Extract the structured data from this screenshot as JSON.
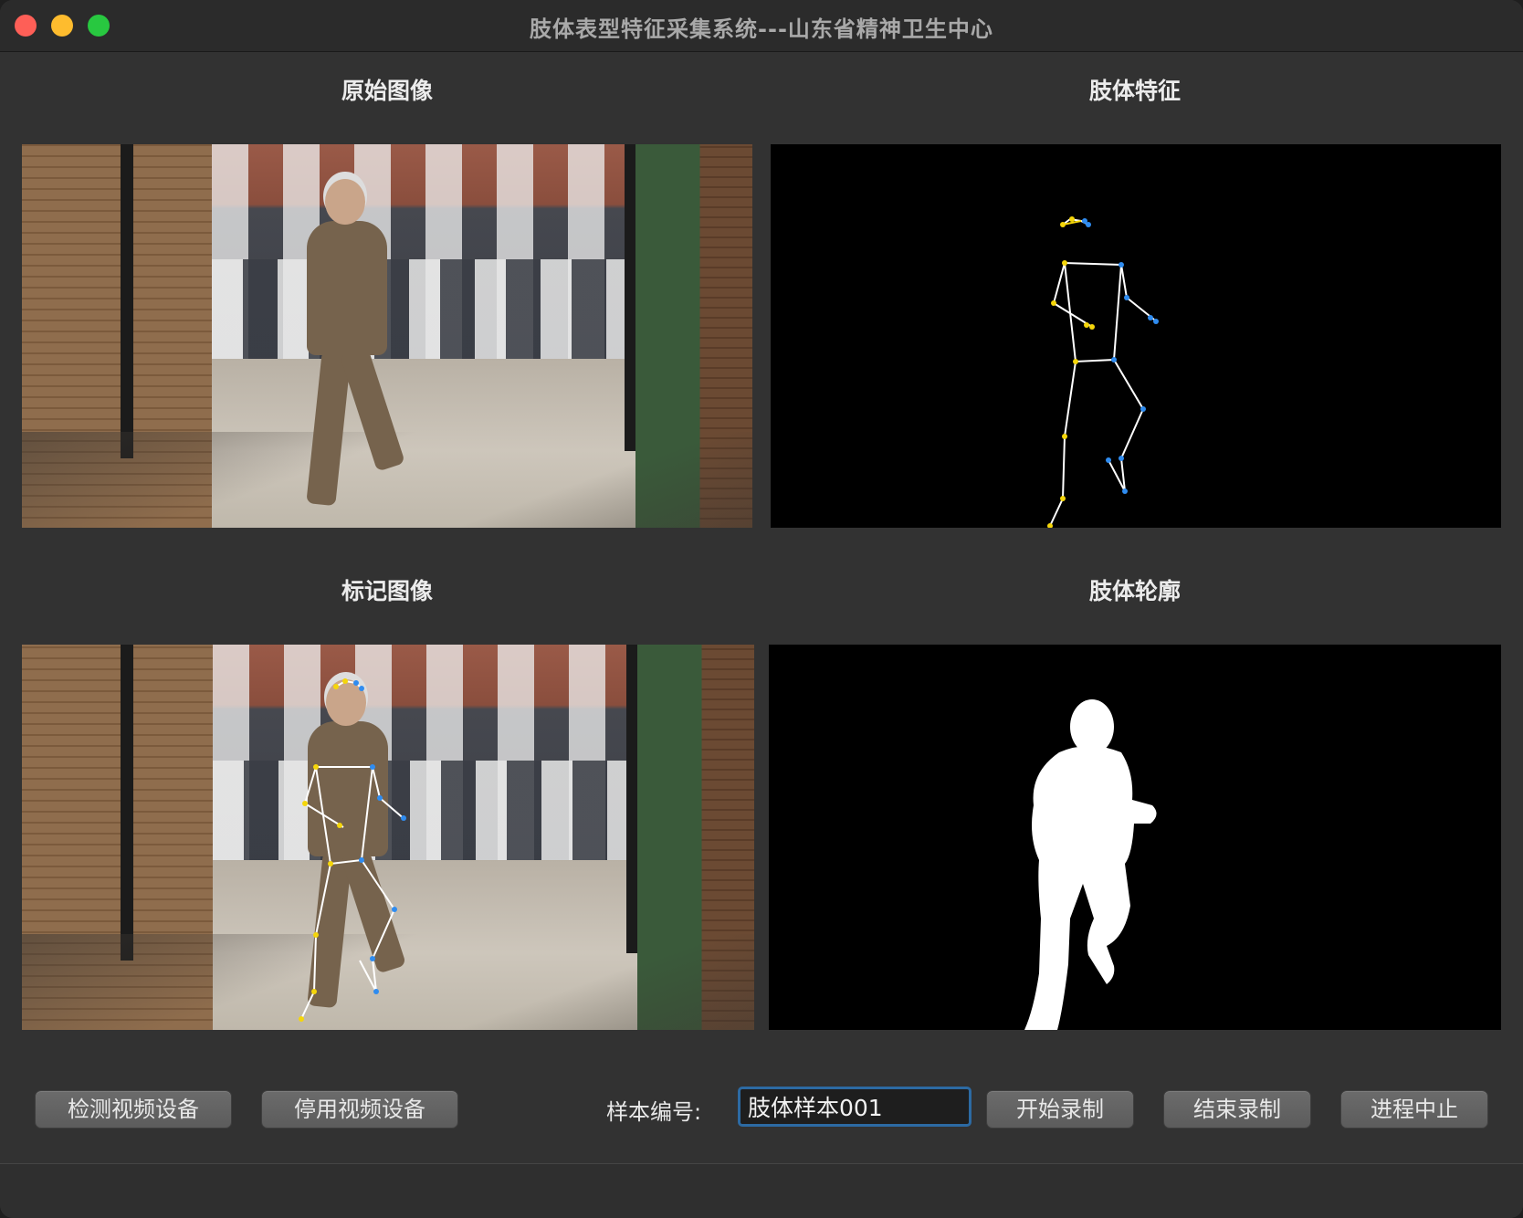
{
  "window": {
    "title": "肢体表型特征采集系统---山东省精神卫生中心"
  },
  "panels": {
    "original": "原始图像",
    "features": "肢体特征",
    "marked": "标记图像",
    "contour": "肢体轮廓"
  },
  "controls": {
    "detect_button": "检测视频设备",
    "disable_button": "停用视频设备",
    "sample_label": "样本编号:",
    "sample_value": "肢体样本001",
    "start_button": "开始录制",
    "stop_button": "结束录制",
    "abort_button": "进程中止"
  },
  "colors": {
    "accent": "#2c6aa3",
    "keypoint_left": "#f5d60a",
    "keypoint_right": "#2f8cf0",
    "skeleton": "#ffffff"
  }
}
